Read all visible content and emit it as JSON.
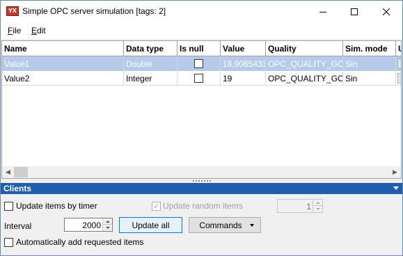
{
  "window": {
    "icon_text": "YX",
    "title": "Simple OPC server simulation [tags: 2]"
  },
  "menu": {
    "file": {
      "accel": "F",
      "rest": "ile"
    },
    "edit": {
      "accel": "E",
      "rest": "dit"
    }
  },
  "grid": {
    "columns": [
      "Name",
      "Data type",
      "Is null",
      "Value",
      "Quality",
      "Sim. mode",
      "U"
    ],
    "rows": [
      {
        "name": "Value1",
        "data_type": "Double",
        "is_null": false,
        "value": "18,9065433",
        "quality": "OPC_QUALITY_GOO",
        "sim_mode": "Sin",
        "selected": true
      },
      {
        "name": "Value2",
        "data_type": "Integer",
        "is_null": false,
        "value": "19",
        "quality": "OPC_QUALITY_GOO",
        "sim_mode": "Sin",
        "selected": false
      }
    ]
  },
  "clients": {
    "header": "Clients",
    "update_by_timer": {
      "label": "Update items by timer",
      "checked": false
    },
    "update_random": {
      "label": "Update random items",
      "checked": true,
      "enabled": false
    },
    "random_count": {
      "value": "1",
      "enabled": false
    },
    "interval": {
      "label": "Interval",
      "value": "2000"
    },
    "update_all_label": "Update all",
    "commands_label": "Commands",
    "auto_add": {
      "label": "Automatically add requested items",
      "checked": false
    }
  },
  "colors": {
    "selection": "#b5cbe9",
    "panel_header": "#1e5eaa",
    "focus_border": "#0078d7"
  },
  "icons": [
    "app-icon",
    "minimize-icon",
    "maximize-icon",
    "close-icon",
    "scroll-left-icon",
    "scroll-right-icon",
    "collapse-arrow-icon",
    "dropdown-arrow-icon",
    "spin-up-icon",
    "spin-down-icon"
  ]
}
